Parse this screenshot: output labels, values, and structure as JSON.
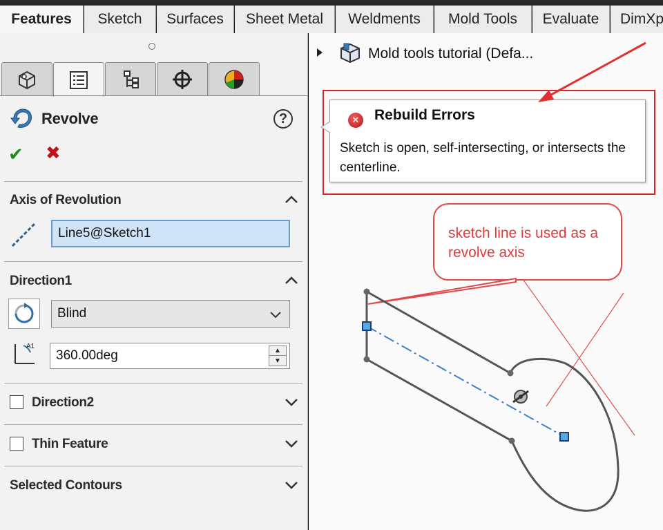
{
  "ribbon": {
    "tabs": [
      "Features",
      "Sketch",
      "Surfaces",
      "Sheet Metal",
      "Weldments",
      "Mold Tools",
      "Evaluate",
      "DimXp"
    ],
    "active_tab": "Features"
  },
  "property_manager": {
    "feature_title": "Revolve",
    "help_label": "?",
    "ok_label": "✔",
    "cancel_label": "✖",
    "tabs": [
      "feature-manager-icon",
      "property-manager-icon",
      "configuration-manager-icon",
      "dimxpert-icon",
      "display-manager-icon"
    ],
    "sections": {
      "axis": {
        "label": "Axis of Revolution",
        "value": "Line5@Sketch1"
      },
      "direction1": {
        "label": "Direction1",
        "end_condition": "Blind",
        "angle": "360.00deg"
      },
      "direction2": {
        "label": "Direction2"
      },
      "thin_feature": {
        "label": "Thin Feature"
      },
      "selected_contours": {
        "label": "Selected Contours"
      }
    }
  },
  "graphics": {
    "tree_title": "Mold tools tutorial  (Defa...",
    "rebuild_error": {
      "title": "Rebuild Errors",
      "message": "Sketch is open, self-intersecting, or intersects the centerline."
    },
    "annotation": "sketch line is used as a revolve axis"
  },
  "colors": {
    "error_red": "#dd2424",
    "annotation_red": "#e23a3a",
    "selection_blue": "#cfe4f7",
    "centerline_blue": "#3a7fd0",
    "ok_green": "#1e8a1e"
  }
}
